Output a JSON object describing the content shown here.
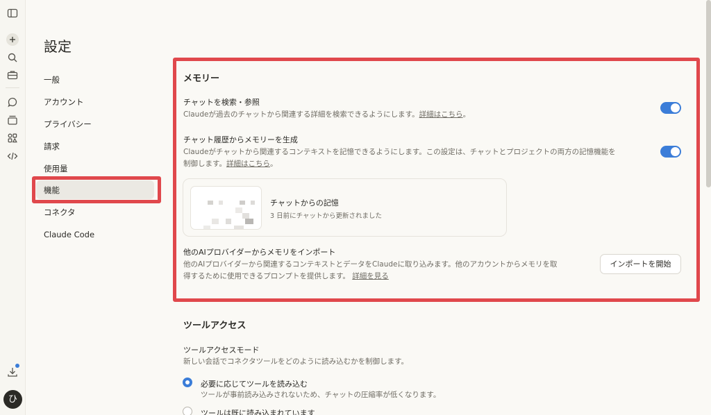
{
  "settings": {
    "title": "設定",
    "nav": [
      {
        "label": "一般"
      },
      {
        "label": "アカウント"
      },
      {
        "label": "プライバシー"
      },
      {
        "label": "請求"
      },
      {
        "label": "使用量"
      },
      {
        "label": "機能",
        "active": true
      },
      {
        "label": "コネクタ"
      },
      {
        "label": "Claude Code"
      }
    ]
  },
  "memory": {
    "heading": "メモリー",
    "search": {
      "title": "チャットを検索・参照",
      "desc": "Claudeが過去のチャットから関連する詳細を検索できるようにします。",
      "link": "詳細はこちら",
      "suffix": "。",
      "enabled": true
    },
    "generate": {
      "title": "チャット履歴からメモリーを生成",
      "desc_line1": "Claudeがチャットから関連するコンテキストを記憶できるようにします。この設定は、チャットとプロジェクトの両方の記憶機能を",
      "desc_line2": "制御します。",
      "link": "詳細はこちら",
      "suffix": "。",
      "enabled": true
    },
    "card": {
      "title": "チャットからの記憶",
      "subtitle": "3 日前にチャットから更新されました"
    },
    "import": {
      "title": "他のAIプロバイダーからメモリをインポート",
      "desc_line1": "他のAIプロバイダーから関連するコンテキストとデータをClaudeに取り込みます。他のアカウントからメモリを取",
      "desc_line2": "得するために使用できるプロンプトを提供します。",
      "link": "詳細を見る",
      "button": "インポートを開始"
    }
  },
  "tools": {
    "heading": "ツールアクセス",
    "mode_title": "ツールアクセスモード",
    "mode_desc": "新しい会話でコネクタツールをどのように読み込むかを制御します。",
    "options": [
      {
        "label": "必要に応じてツールを読み込む",
        "desc": "ツールが事前読み込みされないため、チャットの圧縮率が低くなります。",
        "selected": true
      },
      {
        "label": "ツールは既に読み込まれています",
        "selected": false
      }
    ]
  },
  "user": {
    "avatar_initial": "ひ"
  },
  "icons": [
    "sidebar-toggle-icon",
    "new-chat-icon",
    "search-icon",
    "toolbox-icon",
    "chats-icon",
    "projects-icon",
    "artifacts-icon",
    "code-icon",
    "download-icon"
  ],
  "colors": {
    "accent": "#3b7dd8",
    "highlight": "#e0484c",
    "background": "#faf9f5"
  }
}
